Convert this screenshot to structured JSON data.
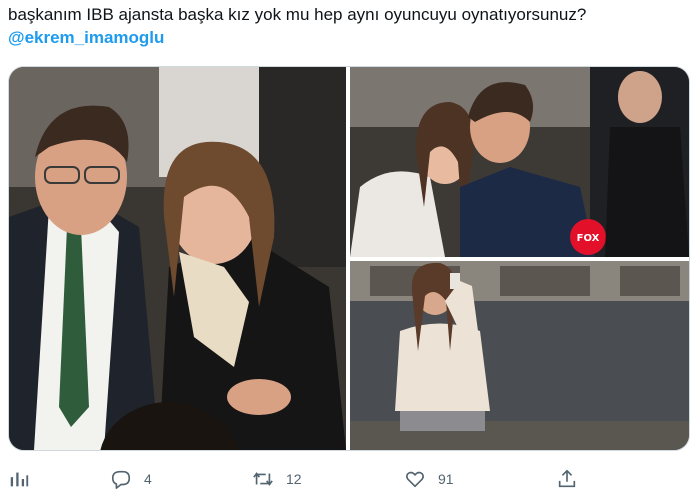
{
  "tweet": {
    "text": "başkanım IBB ajansta başka kız yok mu hep aynı oyuncuyu oynatıyorsunuz?",
    "mention": "@ekrem_imamoglu"
  },
  "media": {
    "photos": [
      {
        "id": "photo-1"
      },
      {
        "id": "photo-2",
        "mic_label": "FOX"
      },
      {
        "id": "photo-3"
      }
    ]
  },
  "actions": {
    "reply_count": "4",
    "retweet_count": "12",
    "like_count": "91"
  },
  "colors": {
    "mention": "#1d9bf0",
    "action_icon": "#536471",
    "mic": "#e3102a"
  },
  "icons": [
    "analytics-icon",
    "reply-icon",
    "retweet-icon",
    "like-icon",
    "share-icon"
  ]
}
